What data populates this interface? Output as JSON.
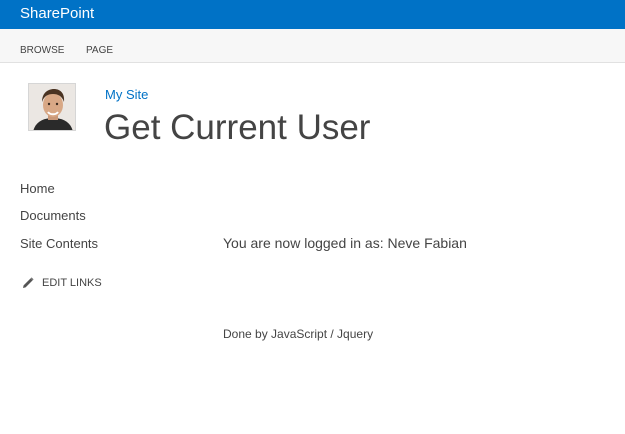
{
  "suite_bar": {
    "brand": "SharePoint",
    "color": "#0072c6"
  },
  "ribbon": {
    "tabs": [
      "BROWSE",
      "PAGE"
    ]
  },
  "site": {
    "link_label": "My Site",
    "title": "Get Current User",
    "avatar_icon": "user-avatar-photo"
  },
  "quick_launch": {
    "items": [
      "Home",
      "Documents",
      "Site Contents"
    ],
    "edit_links_label": "EDIT LINKS",
    "edit_icon": "pencil-icon"
  },
  "content": {
    "message": "You are now logged in as: Neve Fabian",
    "footer": "Done by JavaScript / Jquery"
  }
}
